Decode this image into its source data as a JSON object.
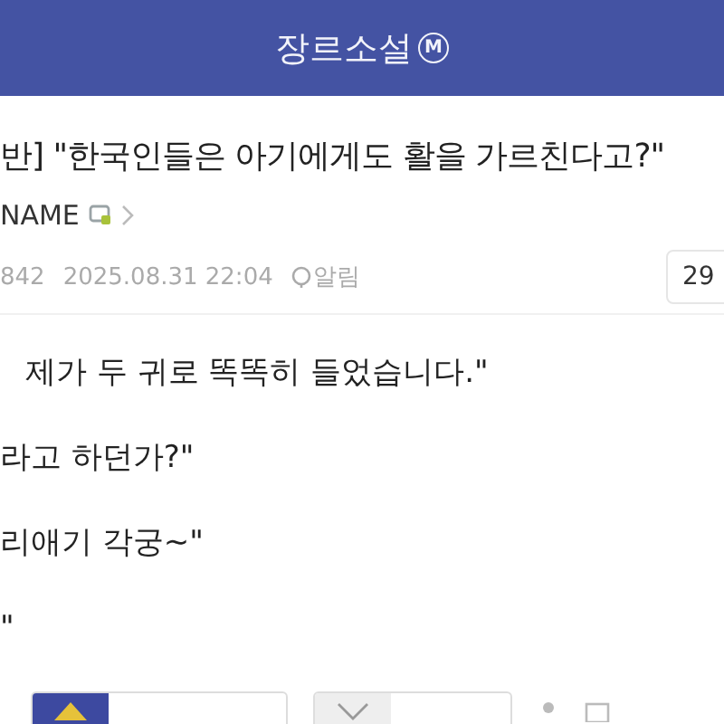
{
  "header": {
    "title": "장르소설",
    "badge": "M"
  },
  "post": {
    "title": "반] \"한국인들은 아기에게도 활을 가르친다고?\"",
    "author": "NAME",
    "views": "842",
    "date": "2025.08.31 22:04",
    "alert": "알림",
    "count": "29"
  },
  "body": [
    "제가 두 귀로 똑똑히 들었습니다.\"",
    "라고 하던가?\"",
    "리애기 각궁~\"",
    "\""
  ]
}
